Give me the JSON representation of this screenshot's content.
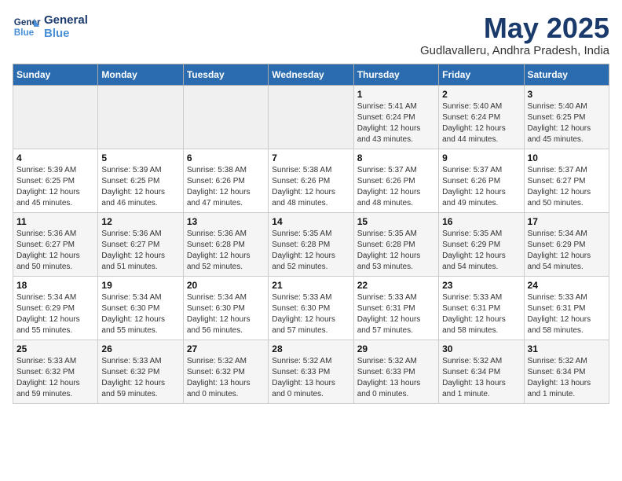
{
  "logo": {
    "line1": "General",
    "line2": "Blue"
  },
  "title": "May 2025",
  "subtitle": "Gudlavalleru, Andhra Pradesh, India",
  "days_header": [
    "Sunday",
    "Monday",
    "Tuesday",
    "Wednesday",
    "Thursday",
    "Friday",
    "Saturday"
  ],
  "weeks": [
    [
      {
        "day": "",
        "content": ""
      },
      {
        "day": "",
        "content": ""
      },
      {
        "day": "",
        "content": ""
      },
      {
        "day": "",
        "content": ""
      },
      {
        "day": "1",
        "content": "Sunrise: 5:41 AM\nSunset: 6:24 PM\nDaylight: 12 hours\nand 43 minutes."
      },
      {
        "day": "2",
        "content": "Sunrise: 5:40 AM\nSunset: 6:24 PM\nDaylight: 12 hours\nand 44 minutes."
      },
      {
        "day": "3",
        "content": "Sunrise: 5:40 AM\nSunset: 6:25 PM\nDaylight: 12 hours\nand 45 minutes."
      }
    ],
    [
      {
        "day": "4",
        "content": "Sunrise: 5:39 AM\nSunset: 6:25 PM\nDaylight: 12 hours\nand 45 minutes."
      },
      {
        "day": "5",
        "content": "Sunrise: 5:39 AM\nSunset: 6:25 PM\nDaylight: 12 hours\nand 46 minutes."
      },
      {
        "day": "6",
        "content": "Sunrise: 5:38 AM\nSunset: 6:26 PM\nDaylight: 12 hours\nand 47 minutes."
      },
      {
        "day": "7",
        "content": "Sunrise: 5:38 AM\nSunset: 6:26 PM\nDaylight: 12 hours\nand 48 minutes."
      },
      {
        "day": "8",
        "content": "Sunrise: 5:37 AM\nSunset: 6:26 PM\nDaylight: 12 hours\nand 48 minutes."
      },
      {
        "day": "9",
        "content": "Sunrise: 5:37 AM\nSunset: 6:26 PM\nDaylight: 12 hours\nand 49 minutes."
      },
      {
        "day": "10",
        "content": "Sunrise: 5:37 AM\nSunset: 6:27 PM\nDaylight: 12 hours\nand 50 minutes."
      }
    ],
    [
      {
        "day": "11",
        "content": "Sunrise: 5:36 AM\nSunset: 6:27 PM\nDaylight: 12 hours\nand 50 minutes."
      },
      {
        "day": "12",
        "content": "Sunrise: 5:36 AM\nSunset: 6:27 PM\nDaylight: 12 hours\nand 51 minutes."
      },
      {
        "day": "13",
        "content": "Sunrise: 5:36 AM\nSunset: 6:28 PM\nDaylight: 12 hours\nand 52 minutes."
      },
      {
        "day": "14",
        "content": "Sunrise: 5:35 AM\nSunset: 6:28 PM\nDaylight: 12 hours\nand 52 minutes."
      },
      {
        "day": "15",
        "content": "Sunrise: 5:35 AM\nSunset: 6:28 PM\nDaylight: 12 hours\nand 53 minutes."
      },
      {
        "day": "16",
        "content": "Sunrise: 5:35 AM\nSunset: 6:29 PM\nDaylight: 12 hours\nand 54 minutes."
      },
      {
        "day": "17",
        "content": "Sunrise: 5:34 AM\nSunset: 6:29 PM\nDaylight: 12 hours\nand 54 minutes."
      }
    ],
    [
      {
        "day": "18",
        "content": "Sunrise: 5:34 AM\nSunset: 6:29 PM\nDaylight: 12 hours\nand 55 minutes."
      },
      {
        "day": "19",
        "content": "Sunrise: 5:34 AM\nSunset: 6:30 PM\nDaylight: 12 hours\nand 55 minutes."
      },
      {
        "day": "20",
        "content": "Sunrise: 5:34 AM\nSunset: 6:30 PM\nDaylight: 12 hours\nand 56 minutes."
      },
      {
        "day": "21",
        "content": "Sunrise: 5:33 AM\nSunset: 6:30 PM\nDaylight: 12 hours\nand 57 minutes."
      },
      {
        "day": "22",
        "content": "Sunrise: 5:33 AM\nSunset: 6:31 PM\nDaylight: 12 hours\nand 57 minutes."
      },
      {
        "day": "23",
        "content": "Sunrise: 5:33 AM\nSunset: 6:31 PM\nDaylight: 12 hours\nand 58 minutes."
      },
      {
        "day": "24",
        "content": "Sunrise: 5:33 AM\nSunset: 6:31 PM\nDaylight: 12 hours\nand 58 minutes."
      }
    ],
    [
      {
        "day": "25",
        "content": "Sunrise: 5:33 AM\nSunset: 6:32 PM\nDaylight: 12 hours\nand 59 minutes."
      },
      {
        "day": "26",
        "content": "Sunrise: 5:33 AM\nSunset: 6:32 PM\nDaylight: 12 hours\nand 59 minutes."
      },
      {
        "day": "27",
        "content": "Sunrise: 5:32 AM\nSunset: 6:32 PM\nDaylight: 13 hours\nand 0 minutes."
      },
      {
        "day": "28",
        "content": "Sunrise: 5:32 AM\nSunset: 6:33 PM\nDaylight: 13 hours\nand 0 minutes."
      },
      {
        "day": "29",
        "content": "Sunrise: 5:32 AM\nSunset: 6:33 PM\nDaylight: 13 hours\nand 0 minutes."
      },
      {
        "day": "30",
        "content": "Sunrise: 5:32 AM\nSunset: 6:34 PM\nDaylight: 13 hours\nand 1 minute."
      },
      {
        "day": "31",
        "content": "Sunrise: 5:32 AM\nSunset: 6:34 PM\nDaylight: 13 hours\nand 1 minute."
      }
    ]
  ]
}
